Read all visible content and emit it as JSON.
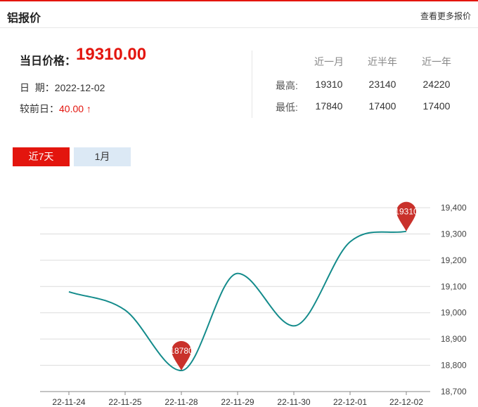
{
  "header": {
    "title": "铝报价",
    "more_link": "查看更多报价"
  },
  "summary": {
    "price_label": "当日价格：",
    "price_value": "19310.00",
    "date_label": "日  期：",
    "date_value": "2022-12-02",
    "change_label": "较前日：",
    "change_value": "40.00 ↑"
  },
  "stats": {
    "headers": [
      "近一月",
      "近半年",
      "近一年"
    ],
    "rows": [
      {
        "label": "最高:",
        "values": [
          "19310",
          "23140",
          "24220"
        ]
      },
      {
        "label": "最低:",
        "values": [
          "17840",
          "17400",
          "17400"
        ]
      }
    ]
  },
  "tabs": [
    {
      "label": "近7天",
      "active": true
    },
    {
      "label": "1月",
      "active": false
    }
  ],
  "colors": {
    "accent": "#e3150e",
    "line": "#138b8b",
    "pin": "#c9312b",
    "tab_inactive": "#dce9f5"
  },
  "chart_data": {
    "type": "line",
    "categories": [
      "22-11-24",
      "22-11-25",
      "22-11-28",
      "22-11-29",
      "22-11-30",
      "22-12-01",
      "22-12-02"
    ],
    "series": [
      {
        "values": [
          19080,
          19010,
          18780,
          19150,
          18950,
          19270,
          19310
        ]
      }
    ],
    "ylim": [
      18700,
      19400
    ],
    "yticks": [
      "18,700",
      "18,800",
      "18,900",
      "19,000",
      "19,100",
      "19,200",
      "19,300",
      "19,400"
    ],
    "ytick_values": [
      18700,
      18800,
      18900,
      19000,
      19100,
      19200,
      19300,
      19400
    ],
    "markers": [
      {
        "label": "18780",
        "index": 2,
        "value": 18780
      },
      {
        "label": "19310",
        "index": 6,
        "value": 19310
      }
    ],
    "grid": true,
    "yaxis_position": "right",
    "smooth": true
  }
}
